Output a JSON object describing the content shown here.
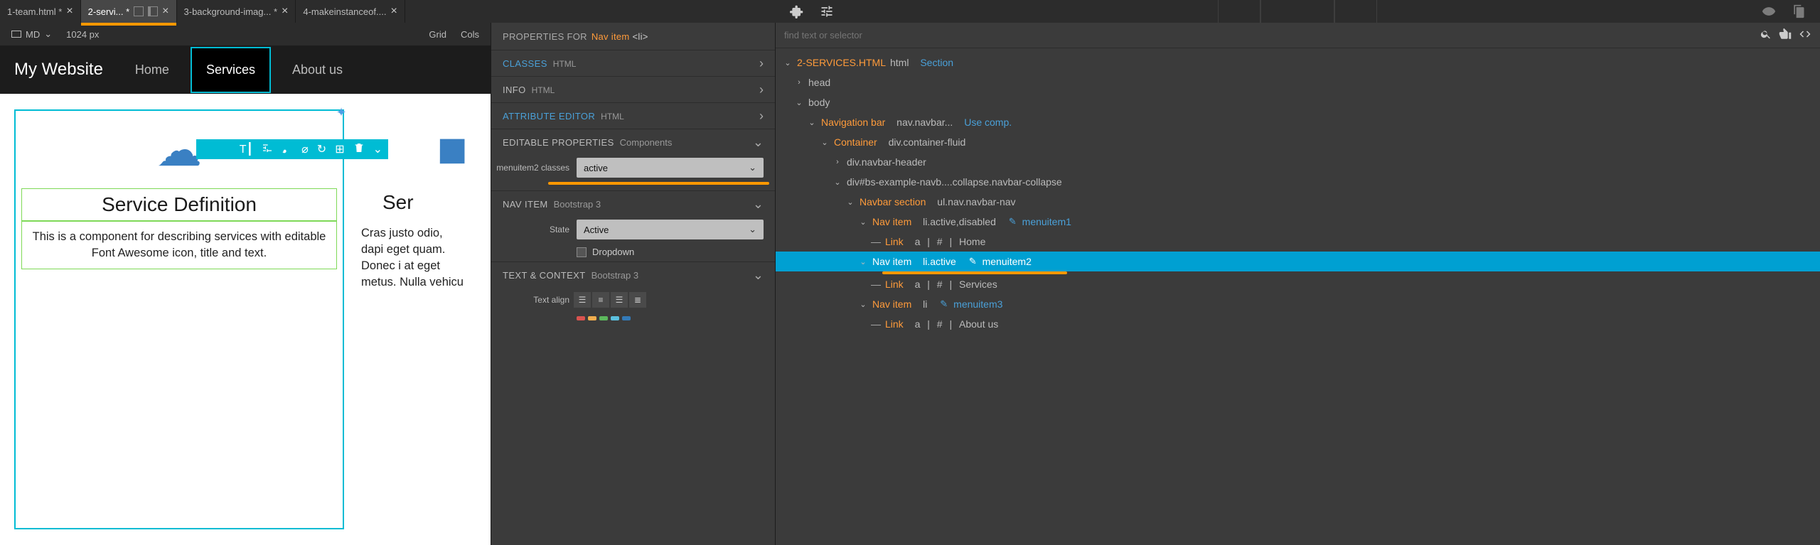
{
  "tabs": [
    {
      "label": "1-team.html *"
    },
    {
      "label": "2-servi... *"
    },
    {
      "label": "3-background-imag... *"
    },
    {
      "label": "4-makeinstanceof...."
    }
  ],
  "subtool": {
    "breakpoint": "MD",
    "px": "1024 px",
    "grid": "Grid",
    "cols": "Cols"
  },
  "webpage": {
    "brand": "My Website",
    "nav": {
      "home": "Home",
      "services": "Services",
      "about": "About us"
    },
    "card1": {
      "title": "Service Definition",
      "text": "This is a component for describing services with editable Font Awesome icon, title and text."
    },
    "card2": {
      "title": "Ser",
      "text": "Cras justo odio, dapi eget quam. Donec i at eget metus. Nulla vehicu"
    }
  },
  "props": {
    "header_for": "PROPERTIES FOR",
    "header_item": "Nav item",
    "header_tag": "<li>",
    "classes": {
      "t": "CLASSES",
      "sub": "HTML"
    },
    "info": {
      "t": "INFO",
      "sub": "HTML"
    },
    "attr": {
      "t": "ATTRIBUTE EDITOR",
      "sub": "HTML"
    },
    "editable": {
      "t": "EDITABLE PROPERTIES",
      "sub": "Components"
    },
    "menuitem2_label": "menuitem2 classes",
    "menuitem2_value": "active",
    "navitem": {
      "t": "NAV ITEM",
      "sub": "Bootstrap 3"
    },
    "state_label": "State",
    "state_value": "Active",
    "dropdown_label": "Dropdown",
    "textctx": {
      "t": "TEXT & CONTEXT",
      "sub": "Bootstrap 3"
    },
    "textalign_label": "Text align"
  },
  "tree": {
    "search_placeholder": "find text or selector",
    "file": "2-SERVICES.HTML",
    "file_sub": "html",
    "file_link": "Section",
    "head": "head",
    "body": "body",
    "navbar": "Navigation bar",
    "navbar_sub": "nav.navbar...",
    "navbar_link": "Use comp.",
    "container": "Container",
    "container_sub": "div.container-fluid",
    "navheader": "div.navbar-header",
    "collapse": "div#bs-example-navb....collapse.navbar-collapse",
    "navsection": "Navbar section",
    "navsection_sub": "ul.nav.navbar-nav",
    "item1": "Nav item",
    "item1_sub": "li.active,disabled",
    "item1_id": "menuitem1",
    "link1a": "Link",
    "link1b": "a",
    "link1c": "#",
    "link1d": "Home",
    "item2": "Nav item",
    "item2_sub": "li.active",
    "item2_id": "menuitem2",
    "link2a": "Link",
    "link2b": "a",
    "link2c": "#",
    "link2d": "Services",
    "item3": "Nav item",
    "item3_sub": "li",
    "item3_id": "menuitem3",
    "link3a": "Link",
    "link3b": "a",
    "link3c": "#",
    "link3d": "About us"
  }
}
